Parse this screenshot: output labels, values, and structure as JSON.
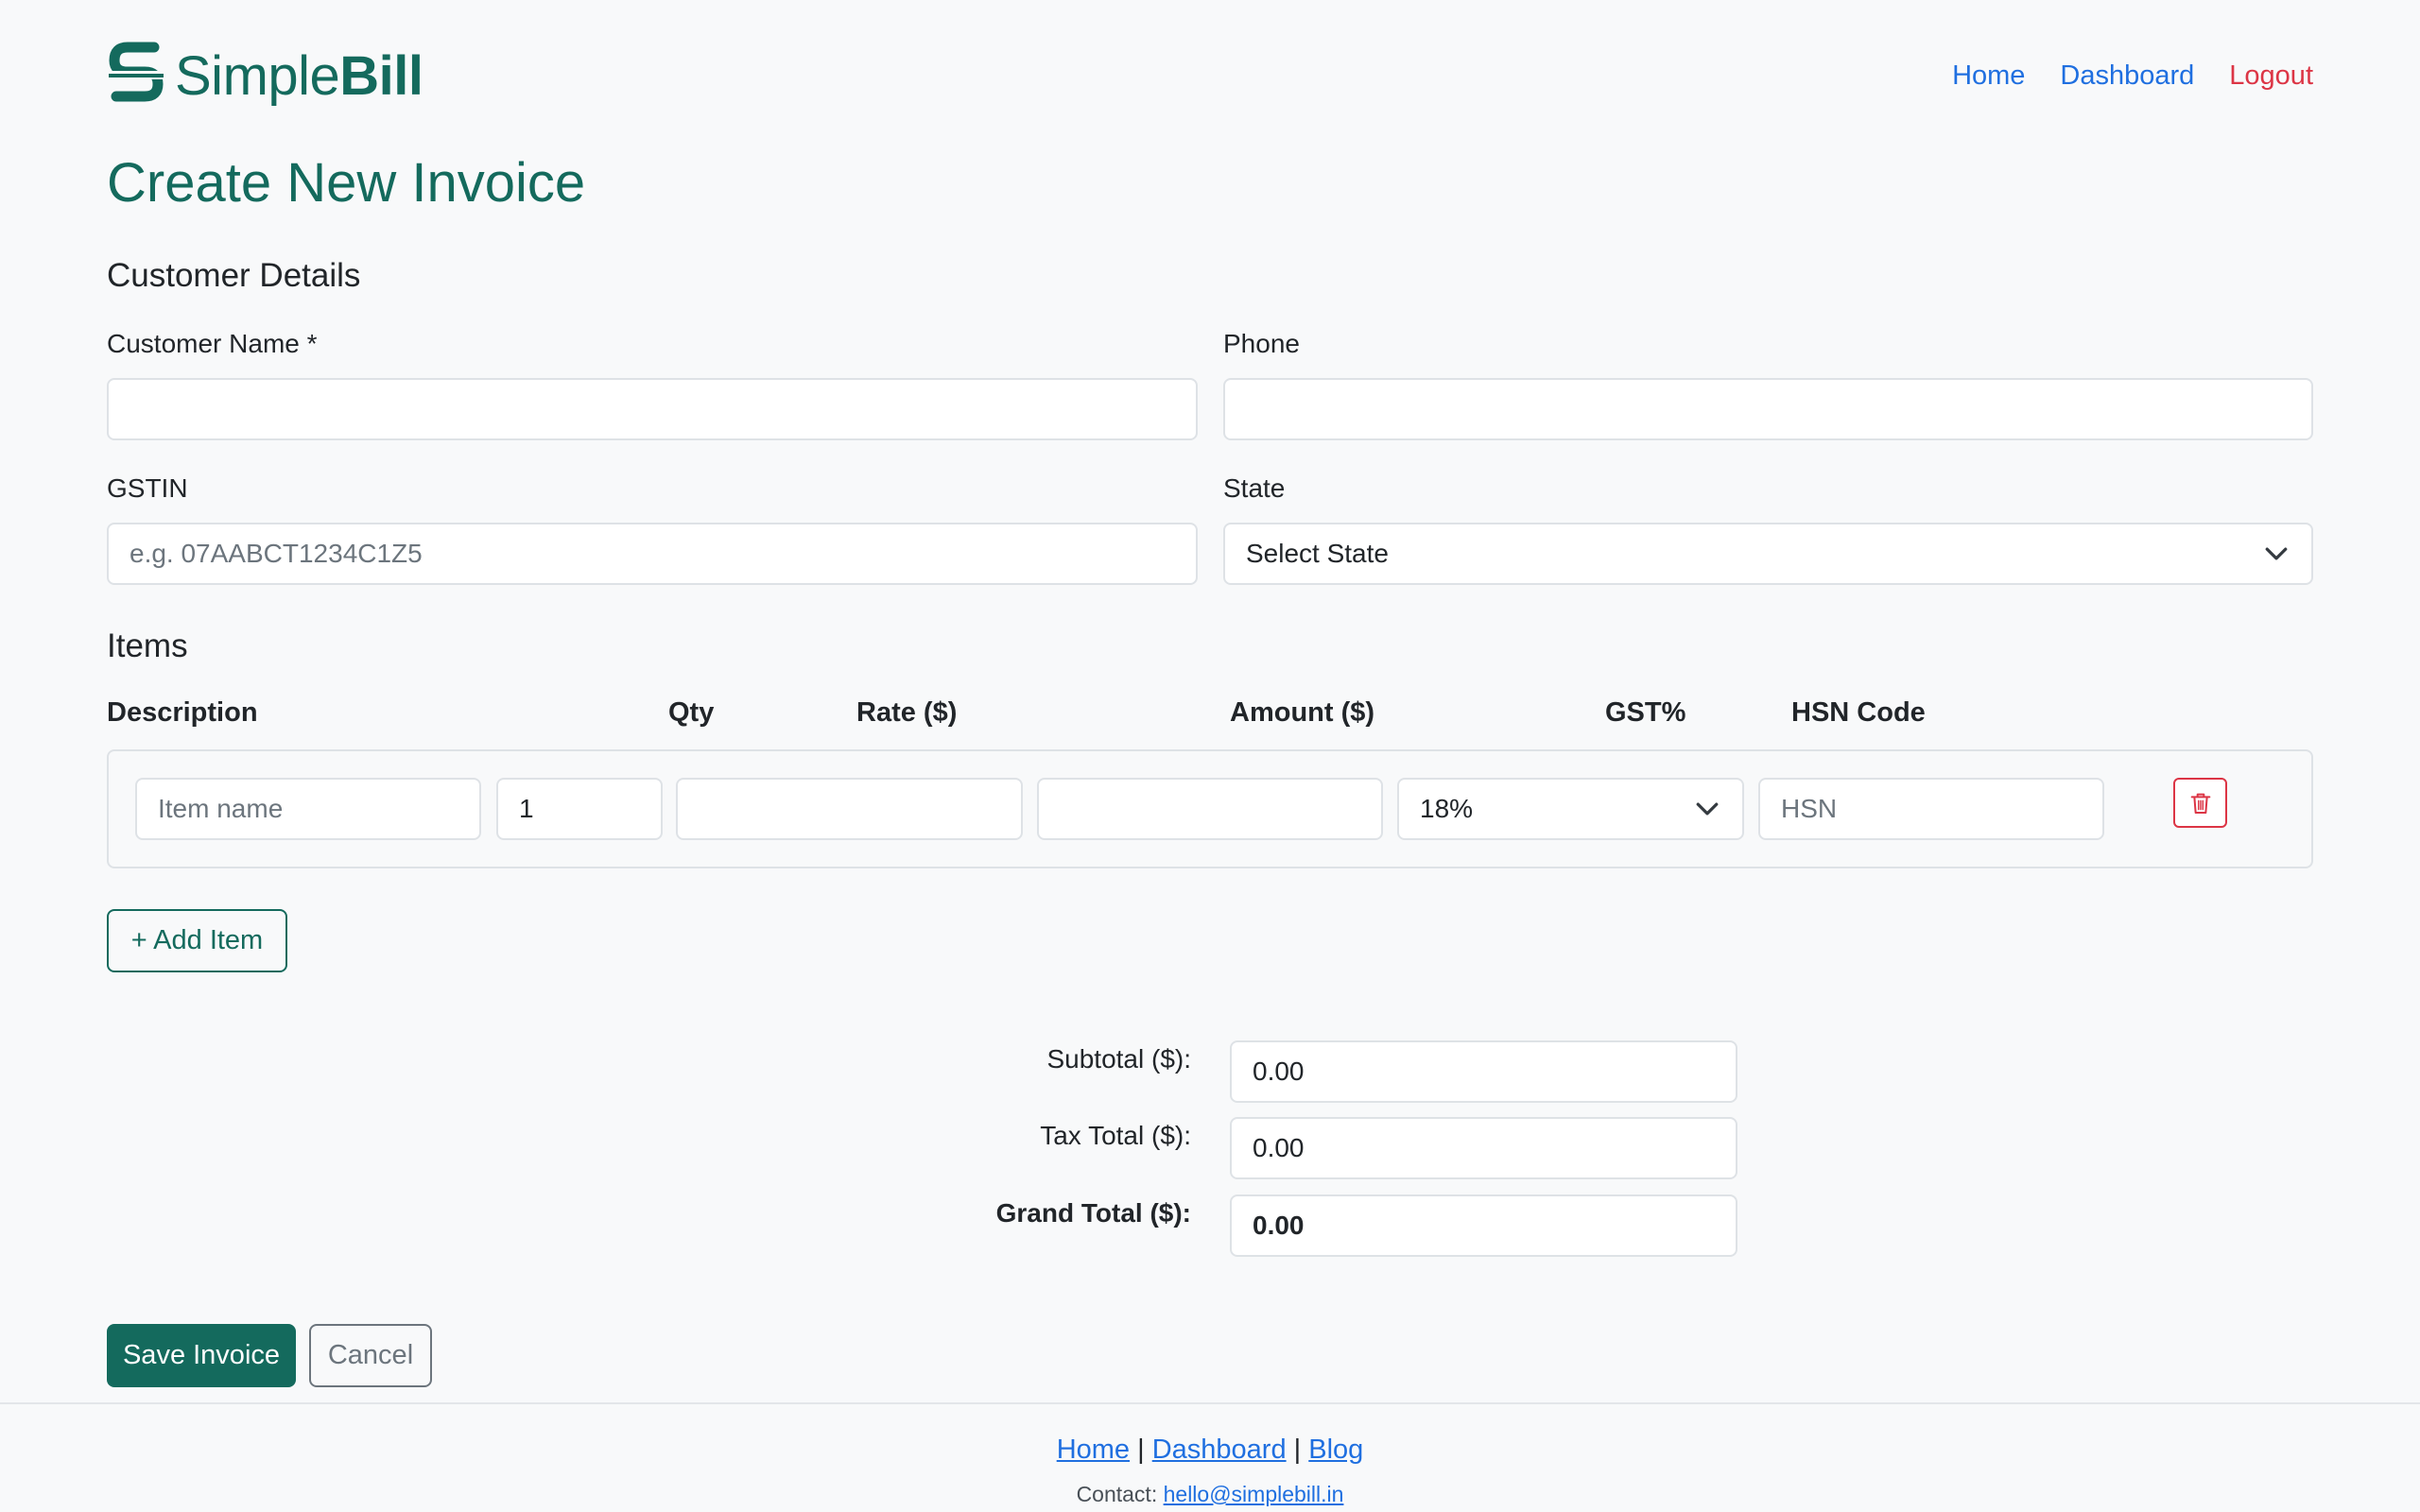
{
  "brand": {
    "simple": "Simple",
    "bill": "Bill"
  },
  "nav": {
    "home": "Home",
    "dashboard": "Dashboard",
    "logout": "Logout"
  },
  "page_title": "Create New Invoice",
  "customer": {
    "section_title": "Customer Details",
    "name_label": "Customer Name *",
    "name_value": "",
    "phone_label": "Phone",
    "phone_value": "",
    "gstin_label": "GSTIN",
    "gstin_placeholder": "e.g. 07AABCT1234C1Z5",
    "state_label": "State",
    "state_selected": "Select State"
  },
  "items": {
    "section_title": "Items",
    "columns": {
      "description": "Description",
      "qty": "Qty",
      "rate": "Rate ($)",
      "amount": "Amount ($)",
      "gst": "GST%",
      "hsn": "HSN Code"
    },
    "rows": [
      {
        "description_placeholder": "Item name",
        "qty": "1",
        "rate": "",
        "amount": "",
        "gst_selected": "18%",
        "hsn_placeholder": "HSN"
      }
    ],
    "add_button": "+ Add Item"
  },
  "totals": {
    "subtotal_label": "Subtotal ($):",
    "subtotal_value": "0.00",
    "tax_label": "Tax Total ($):",
    "tax_value": "0.00",
    "grand_label": "Grand Total ($):",
    "grand_value": "0.00"
  },
  "actions": {
    "save": "Save Invoice",
    "cancel": "Cancel"
  },
  "footer": {
    "links": [
      "Home",
      "Dashboard",
      "Blog"
    ],
    "separator": "|",
    "contact_label": "Contact:",
    "contact_email": "hello@simplebill.in"
  },
  "colors": {
    "brand": "#146a5d",
    "link": "#1f6fe0",
    "danger": "#dc3545",
    "background": "#f8f9fa"
  },
  "icons": {
    "logo": "simplebill-s-logo",
    "state_chevron": "chevron-down-icon",
    "gst_chevron": "chevron-down-icon",
    "delete": "trash-icon"
  }
}
